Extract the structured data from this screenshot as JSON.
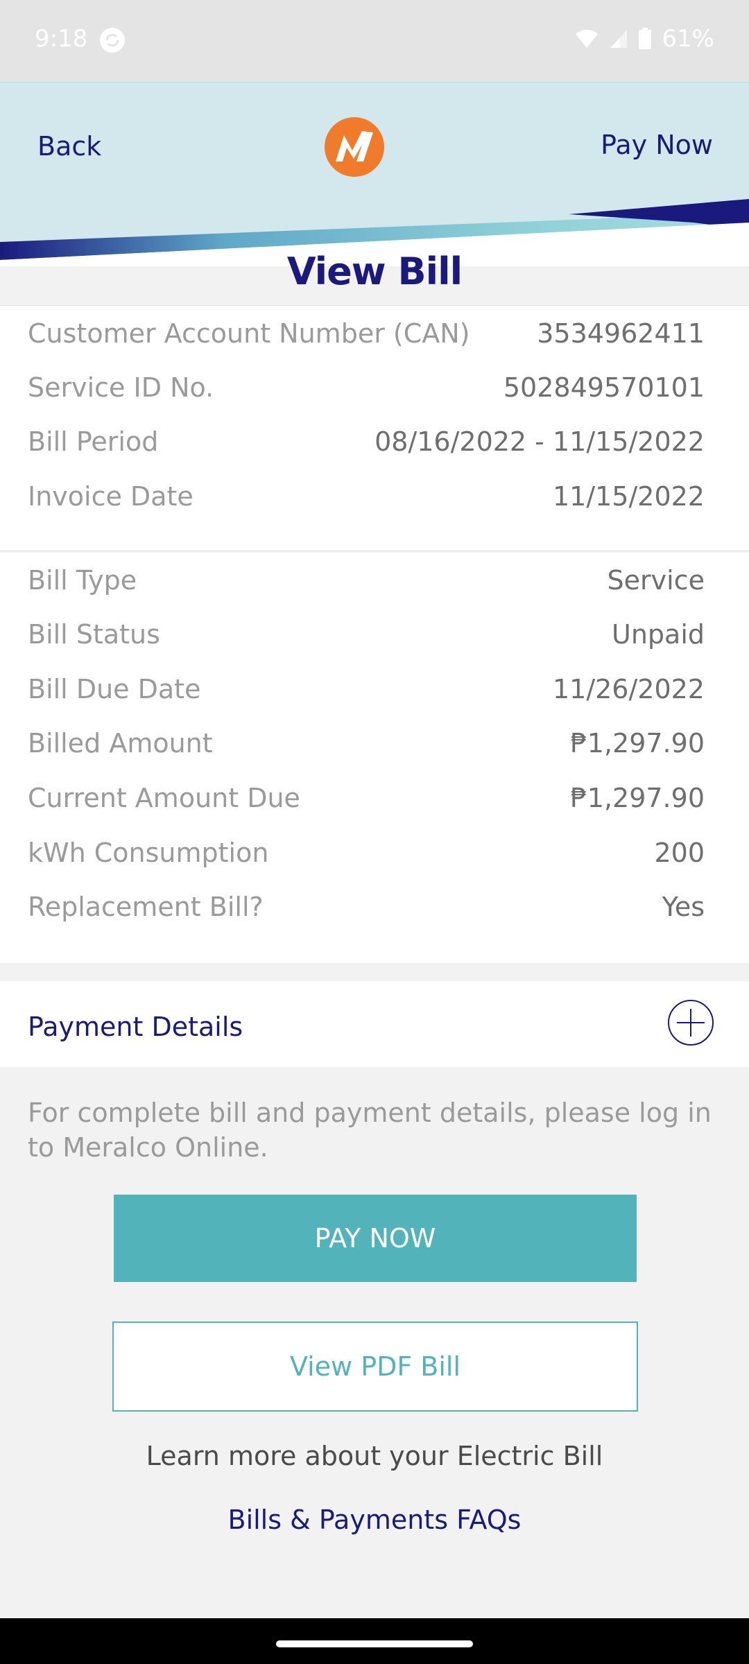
{
  "status_bar": {
    "time": "9:18",
    "battery": "61%"
  },
  "header": {
    "back_label": "Back",
    "pay_now_label": "Pay Now",
    "logo_letter": "M"
  },
  "page_title": "View Bill",
  "account_details": [
    {
      "label": "Customer Account Number (CAN)",
      "value": "3534962411"
    },
    {
      "label": "Service ID No.",
      "value": "502849570101"
    },
    {
      "label": "Bill Period",
      "value": "08/16/2022 - 11/15/2022"
    },
    {
      "label": "Invoice Date",
      "value": "11/15/2022"
    }
  ],
  "bill_details": [
    {
      "label": "Bill Type",
      "value": "Service"
    },
    {
      "label": "Bill Status",
      "value": "Unpaid"
    },
    {
      "label": "Bill Due Date",
      "value": "11/26/2022"
    },
    {
      "label": "Billed Amount",
      "value": "₱1,297.90"
    },
    {
      "label": "Current Amount Due",
      "value": "₱1,297.90"
    },
    {
      "label": "kWh Consumption",
      "value": "200"
    },
    {
      "label": "Replacement Bill?",
      "value": "Yes"
    }
  ],
  "payment_details": {
    "title": "Payment Details"
  },
  "info_text": "For complete bill and payment details, please log in to Meralco Online.",
  "buttons": {
    "pay_now": "PAY NOW",
    "view_pdf": "View PDF Bill"
  },
  "learn_more": "Learn more about your Electric Bill",
  "faq_link": "Bills & Payments FAQs",
  "colors": {
    "brand_navy": "#1a1a7e",
    "teal": "#52b4ba",
    "orange": "#f07b2a",
    "header_bg": "#d3e8ed"
  }
}
